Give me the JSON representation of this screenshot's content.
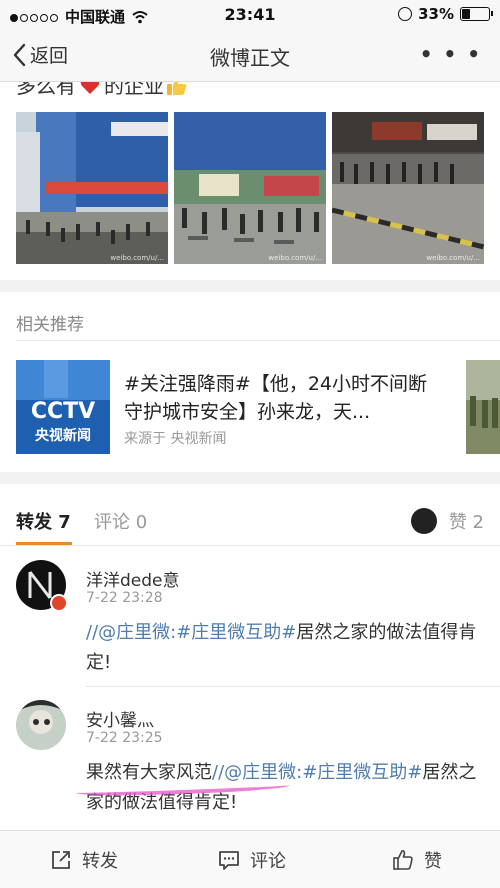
{
  "status_bar": {
    "carrier": "中国联通",
    "time": "23:41",
    "battery": "33%",
    "battery_level": 0.33
  },
  "nav": {
    "back_label": "返回",
    "title": "微博正文",
    "more_label": "• • •"
  },
  "post": {
    "truncated_text_start": "多么有",
    "truncated_text_end": "的企业",
    "photo_watermark": "weibo.com/u/..."
  },
  "related": {
    "section_title": "相关推荐",
    "card": {
      "title": "#关注强降雨#【他，24小时不间断守护城市安全】孙来龙，天...",
      "source": "来源于 央视新闻",
      "thumb_logo": "CCTV",
      "thumb_caption": "央视新闻"
    }
  },
  "tabs": {
    "repost": "转发 7",
    "comment": "评论 0",
    "like": "赞 2"
  },
  "reposts": [
    {
      "name": "洋洋dede意",
      "time": "7-22 23:28",
      "link1": "//@庄里微:",
      "link2": "#庄里微互助#",
      "text_after": "居然之家的做法值得肯定!"
    },
    {
      "name": "安小馨灬",
      "time": "7-22 23:25",
      "text_before": "果然有大家风范",
      "link1": "//@庄里微:",
      "link2": "#庄里微互助#",
      "text_after": "居然之家的做法值得肯定!"
    }
  ],
  "toolbar": {
    "repost_label": "转发",
    "comment_label": "评论",
    "like_label": "赞"
  }
}
